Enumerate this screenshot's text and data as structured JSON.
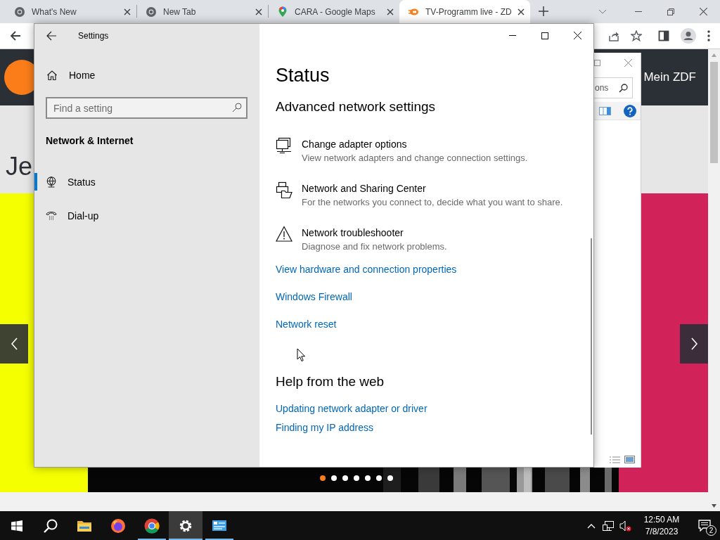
{
  "browser": {
    "tabs": [
      {
        "kind": "chrome",
        "title": "What's New",
        "selected": false
      },
      {
        "kind": "chrome",
        "title": "New Tab",
        "selected": false
      },
      {
        "kind": "maps",
        "title": "CARA - Google Maps",
        "selected": false
      },
      {
        "kind": "zdf",
        "title": "TV-Programm live - ZD",
        "selected": true
      }
    ]
  },
  "page": {
    "header_link": "Mein ZDF",
    "heading": "Je",
    "carousel_dots": [
      {
        "selected": true
      },
      {
        "selected": false
      },
      {
        "selected": false
      },
      {
        "selected": false
      },
      {
        "selected": false
      },
      {
        "selected": false
      },
      {
        "selected": false
      }
    ]
  },
  "background_dialog": {
    "search_value": "ons"
  },
  "settings": {
    "title": "Settings",
    "home": "Home",
    "search": {
      "placeholder": "Find a setting"
    },
    "section": "Network & Internet",
    "nav": [
      {
        "kind": "status",
        "label": "Status",
        "selected": true
      },
      {
        "kind": "dialup",
        "label": "Dial-up",
        "selected": false
      }
    ],
    "page_title": "Status",
    "advanced_heading": "Advanced network settings",
    "options": [
      {
        "kind": "adapter",
        "title": "Change adapter options",
        "description": "View network adapters and change connection settings."
      },
      {
        "kind": "sharing",
        "title": "Network and Sharing Center",
        "description": "For the networks you connect to, decide what you want to share."
      },
      {
        "kind": "troubleshooter",
        "title": "Network troubleshooter",
        "description": "Diagnose and fix network problems."
      }
    ],
    "links": [
      "View hardware and connection properties",
      "Windows Firewall",
      "Network reset"
    ],
    "help_heading": "Help from the web",
    "help_links": [
      "Updating network adapter or driver",
      "Finding my IP address"
    ]
  },
  "taskbar": {
    "apps": [
      {
        "kind": "explorer",
        "running": false,
        "selected": false
      },
      {
        "kind": "firefox",
        "running": false,
        "selected": false
      },
      {
        "kind": "chrome",
        "running": true,
        "selected": false
      },
      {
        "kind": "settings",
        "running": true,
        "selected": true
      },
      {
        "kind": "app",
        "running": true,
        "selected": false
      }
    ],
    "time": "12:50 AM",
    "date": "7/8/2023",
    "notifications": "2"
  }
}
